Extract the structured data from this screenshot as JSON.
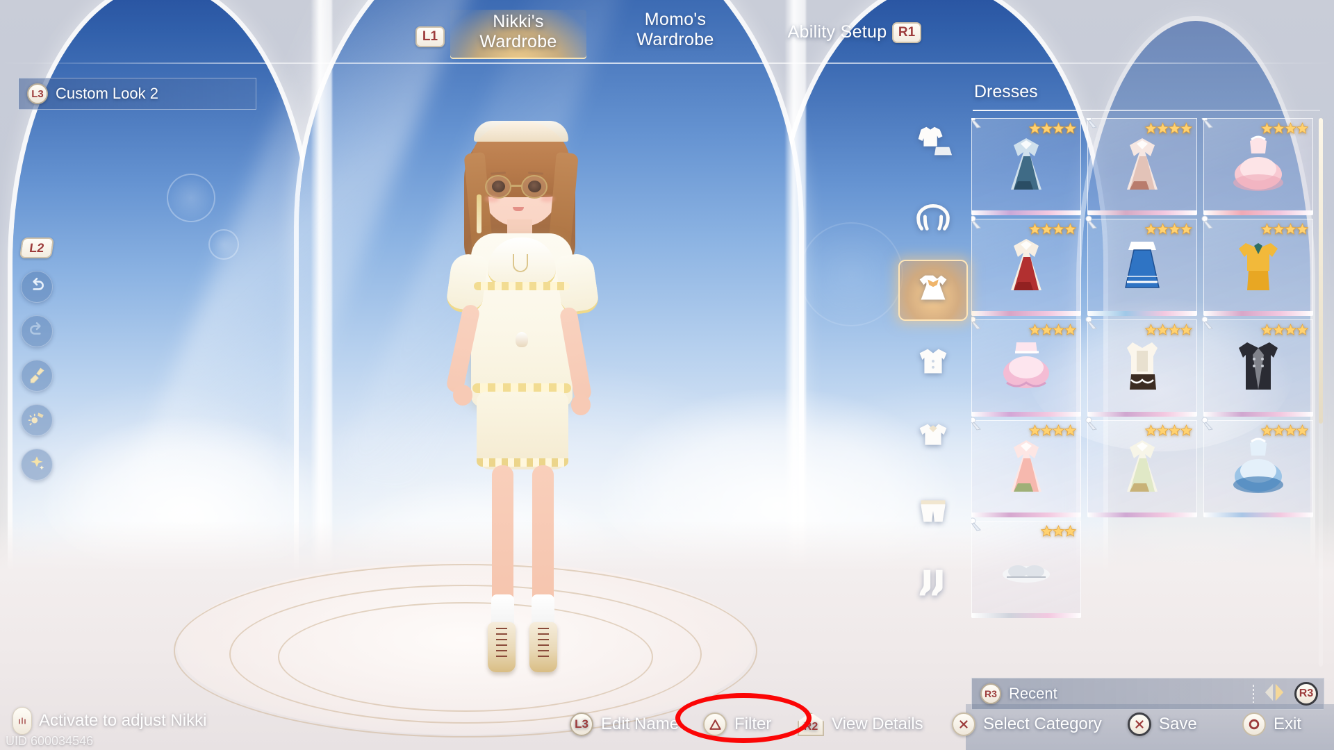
{
  "topnav": {
    "tabs": [
      {
        "label": "Nikki's\nWardrobe",
        "active": true
      },
      {
        "label": "Momo's\nWardrobe",
        "active": false
      },
      {
        "label": "Ability Setup",
        "active": false
      }
    ],
    "left_bumper": "L1",
    "right_bumper": "R1"
  },
  "look_bar": {
    "button": "L3",
    "label": "Custom Look 2"
  },
  "tool_rail": {
    "badge": "L2",
    "items": [
      {
        "icon": "undo-icon"
      },
      {
        "icon": "redo-icon"
      },
      {
        "icon": "brush-icon"
      },
      {
        "icon": "lighting-icon"
      },
      {
        "icon": "sparkle-icon"
      }
    ]
  },
  "category_rail": {
    "items": [
      {
        "icon": "outfit-set-icon",
        "name": "Outfit Set",
        "active": false
      },
      {
        "icon": "hair-icon",
        "name": "Hair",
        "active": false
      },
      {
        "icon": "dress-icon",
        "name": "Dresses",
        "active": true
      },
      {
        "icon": "coat-icon",
        "name": "Coat",
        "active": false
      },
      {
        "icon": "top-icon",
        "name": "Top",
        "active": false
      },
      {
        "icon": "bottoms-icon",
        "name": "Bottoms",
        "active": false
      },
      {
        "icon": "socks-icon",
        "name": "Socks",
        "active": false
      }
    ]
  },
  "panel": {
    "title": "Dresses",
    "columns": 3,
    "items": [
      {
        "stars": 4,
        "colors": [
          "#cfe0ec",
          "#3f6b86",
          "#27485e"
        ],
        "accent": "#c9a8d8",
        "shape": "gown"
      },
      {
        "stars": 4,
        "colors": [
          "#f6e7e2",
          "#e3c3b8",
          "#b2705f"
        ],
        "accent": "#d6aac4",
        "shape": "gown"
      },
      {
        "stars": 4,
        "colors": [
          "#fde4e7",
          "#f8c9d2",
          "#efa9b7"
        ],
        "accent": "#f0a8b4",
        "shape": "puff"
      },
      {
        "stars": 4,
        "colors": [
          "#f7efe3",
          "#b23030",
          "#8c1f1f"
        ],
        "accent": "#d7a4c6",
        "shape": "gown"
      },
      {
        "stars": 4,
        "colors": [
          "#ffffff",
          "#2f74c4",
          "#1d4f92"
        ],
        "accent": "#9fc8e8",
        "shape": "aline"
      },
      {
        "stars": 4,
        "colors": [
          "#f2b93a",
          "#e8a723",
          "#2f6f63"
        ],
        "accent": "#d7a6c8",
        "shape": "suit"
      },
      {
        "stars": 4,
        "colors": [
          "#fde5ee",
          "#f4bcd4",
          "#d99ec6"
        ],
        "accent": "#d3a6d6",
        "shape": "frill"
      },
      {
        "stars": 4,
        "colors": [
          "#fbf6ec",
          "#e8e0cf",
          "#3c2c22"
        ],
        "accent": "#cfa6cf",
        "shape": "apron"
      },
      {
        "stars": 4,
        "colors": [
          "#2a2b33",
          "#1a1b22",
          "#c8ccd4"
        ],
        "accent": "#cfa6cf",
        "shape": "coat"
      },
      {
        "stars": 4,
        "colors": [
          "#fde6e4",
          "#f6b8ae",
          "#8fae6d"
        ],
        "accent": "#d5a7cf",
        "shape": "gown"
      },
      {
        "stars": 4,
        "colors": [
          "#f7f5e8",
          "#e0e8c6",
          "#c3a86a"
        ],
        "accent": "#cfa7d2",
        "shape": "gown"
      },
      {
        "stars": 4,
        "colors": [
          "#e4f0fa",
          "#9cc4e6",
          "#2f6fae"
        ],
        "accent": "#a9c6e6",
        "shape": "puff"
      },
      {
        "stars": 3,
        "colors": [
          "#f4f5f7",
          "#dfe3e9",
          "#b9bfc8"
        ],
        "accent": "#cfd3dc",
        "shape": "flat"
      }
    ]
  },
  "recent_bar": {
    "button": "R3",
    "label": "Recent",
    "sort_button": "R3",
    "sort_icon": "sort-arrows-icon"
  },
  "bottom_bar": {
    "activate_hint": "Activate to adjust Nikki",
    "uid": "UID 600034546",
    "hints": [
      {
        "button": "L3",
        "label": "Edit Name",
        "type": "circle"
      },
      {
        "button": "triangle",
        "label": "Filter",
        "type": "triangle"
      },
      {
        "button": "R2",
        "label": "View Details",
        "type": "shoulder"
      },
      {
        "button": "X",
        "label": "Select Category",
        "type": "cross"
      },
      {
        "button": "X",
        "label": "Save",
        "type": "cross-strong"
      },
      {
        "button": "O",
        "label": "Exit",
        "type": "circleo"
      }
    ]
  },
  "annotation": {
    "shape": "ellipse",
    "color": "#fb0505",
    "target": "Filter"
  }
}
